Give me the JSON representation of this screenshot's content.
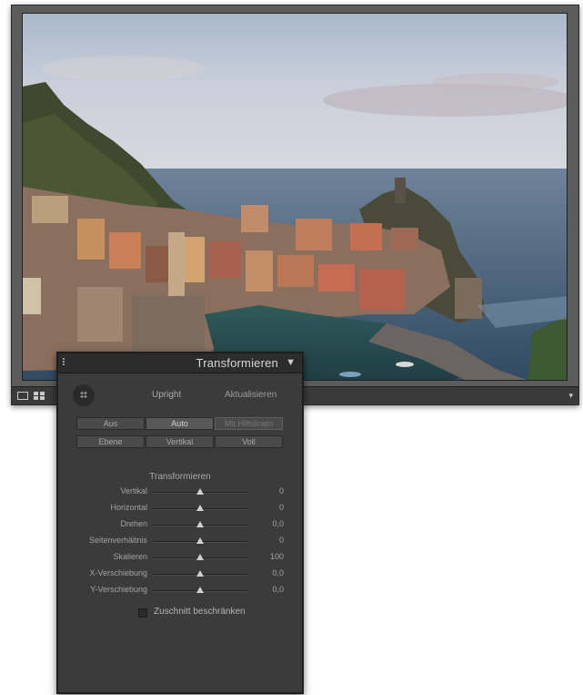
{
  "panel": {
    "title": "Transformieren",
    "collapse_icon": "triangle-down-icon",
    "upright_tool_icon": "crop-grid-icon",
    "upright_label": "Upright",
    "refresh_label": "Aktualisieren",
    "upright_buttons": [
      {
        "label": "Aus",
        "state": "normal"
      },
      {
        "label": "Auto",
        "state": "active"
      },
      {
        "label": "Mit Hilfslinien",
        "state": "disabled"
      },
      {
        "label": "Ebene",
        "state": "normal"
      },
      {
        "label": "Vertikal",
        "state": "normal"
      },
      {
        "label": "Voll",
        "state": "normal"
      }
    ],
    "transform_section_title": "Transformieren",
    "sliders": [
      {
        "label": "Vertikal",
        "value": "0",
        "level": 0.5
      },
      {
        "label": "Horizontal",
        "value": "0",
        "level": 0.5
      },
      {
        "label": "Drehen",
        "value": "0,0",
        "level": 0.5
      },
      {
        "label": "Seitenverhältnis",
        "value": "0",
        "level": 0.5
      },
      {
        "label": "Skalieren",
        "value": "100",
        "level": 0.5
      },
      {
        "label": "X-Verschiebung",
        "value": "0,0",
        "level": 0.5
      },
      {
        "label": "Y-Verschiebung",
        "value": "0,0",
        "level": 0.5
      }
    ],
    "constrain_crop_label": "Zuschnitt beschränken",
    "constrain_crop_checked": false
  },
  "toolbar": {
    "loupe_icon": "loupe-view-icon",
    "grid_icon": "grid-view-icon",
    "menu_icon": "triangle-down-icon"
  },
  "colors": {
    "panel_bg": "#3b3b3b",
    "window_bg": "#5c5c5c"
  }
}
